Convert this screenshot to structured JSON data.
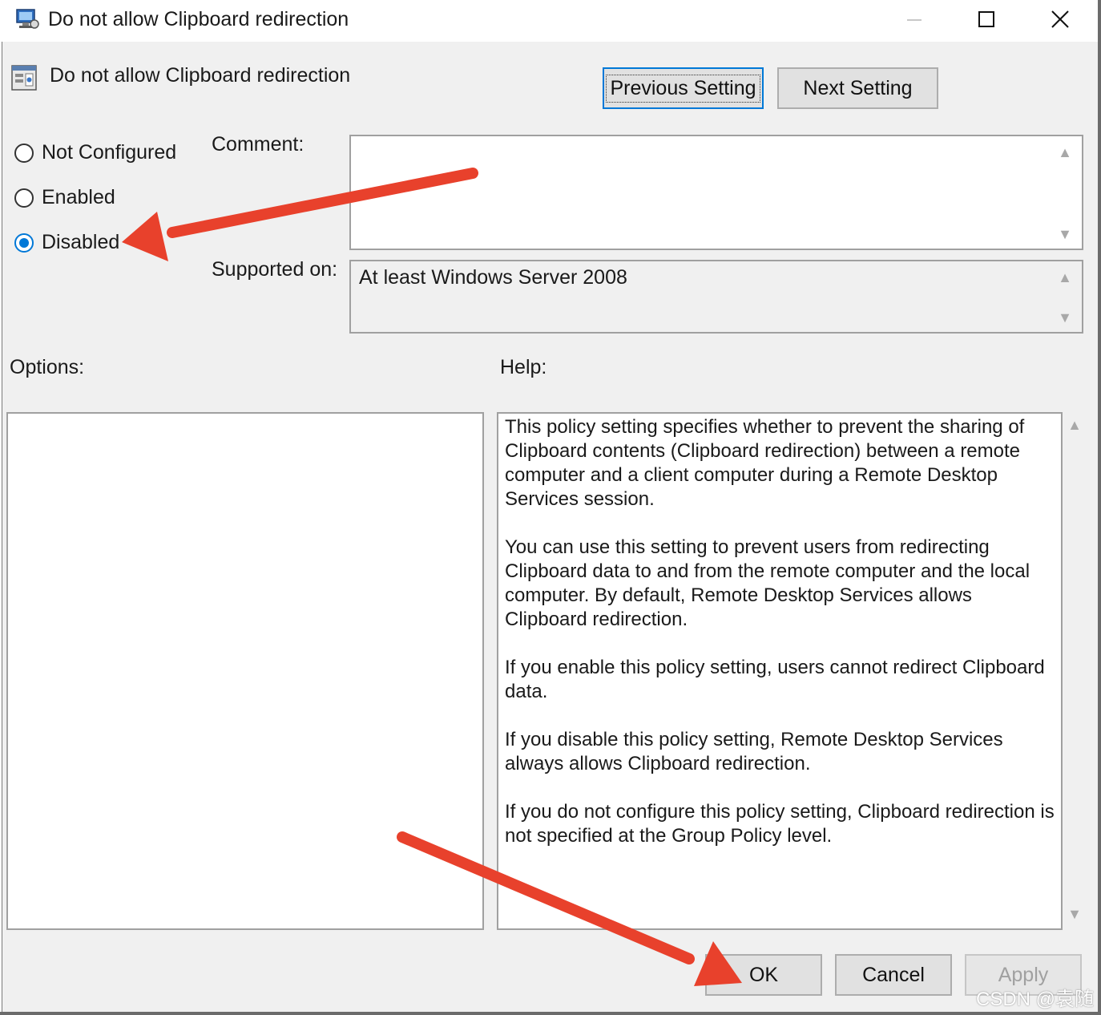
{
  "window": {
    "title": "Do not allow Clipboard redirection",
    "controls": {
      "minimize": "—",
      "maximize": "☐",
      "close": "✕"
    }
  },
  "header": {
    "policy_name": "Do not allow Clipboard redirection",
    "previous_label": "Previous Setting",
    "next_label": "Next Setting"
  },
  "state": {
    "options": [
      "Not Configured",
      "Enabled",
      "Disabled"
    ],
    "selected": "Disabled"
  },
  "fields": {
    "comment_label": "Comment:",
    "comment_value": "",
    "supported_label": "Supported on:",
    "supported_value": "At least Windows Server 2008"
  },
  "panels": {
    "options_label": "Options:",
    "help_label": "Help:",
    "help_paragraphs": [
      "This policy setting specifies whether to prevent the sharing of Clipboard contents (Clipboard redirection) between a remote computer and a client computer during a Remote Desktop Services session.",
      "You can use this setting to prevent users from redirecting Clipboard data to and from the remote computer and the local computer. By default, Remote Desktop Services allows Clipboard redirection.",
      "If you enable this policy setting, users cannot redirect Clipboard data.",
      "If you disable this policy setting, Remote Desktop Services always allows Clipboard redirection.",
      "If you do not configure this policy setting, Clipboard redirection is not specified at the Group Policy level."
    ]
  },
  "footer": {
    "ok_label": "OK",
    "cancel_label": "Cancel",
    "apply_label": "Apply"
  },
  "watermark": "CSDN @袁随",
  "colors": {
    "accent": "#0078d7",
    "annotation_arrow": "#e8412c",
    "dialog_bg": "#f0f0f0"
  },
  "icons": {
    "app": "group-policy-icon",
    "policy": "policy-setting-icon"
  }
}
